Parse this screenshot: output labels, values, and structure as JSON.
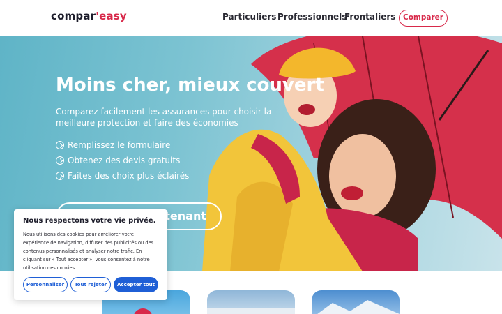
{
  "header": {
    "logo": {
      "part1": "compar",
      "part2": "'easy"
    },
    "nav": [
      {
        "label": "Particuliers"
      },
      {
        "label": "Professionnels"
      },
      {
        "label": "Frontaliers"
      }
    ],
    "cta_label": "Comparer"
  },
  "hero": {
    "title": "Moins cher, mieux couvert",
    "subtitle": "Comparez facilement les assurances pour choisir la meilleure protection et faire des économies",
    "bullets": [
      {
        "icon": "arrow-circle-right-icon",
        "text": "Remplissez le formulaire"
      },
      {
        "icon": "arrow-circle-right-icon",
        "text": "Obtenez des devis gratuits"
      },
      {
        "icon": "arrow-circle-right-icon",
        "text": "Faites des choix plus éclairés"
      }
    ],
    "cta_label": "tenant"
  },
  "cookie": {
    "title": "Nous respectons votre vie privée.",
    "text": "Nous utilisons des cookies pour améliorer votre expérience de navigation, diffuser des publicités ou des contenus personnalisés et analyser notre trafic. En cliquant sur « Tout accepter », vous consentez à notre utilisation des cookies.",
    "buttons": {
      "customize": "Personnaliser",
      "reject": "Tout rejeter",
      "accept": "Accepter tout"
    }
  },
  "colors": {
    "brand_red": "#d8294a",
    "brand_dark": "#1d1d2b",
    "cookie_blue": "#1f5fd6",
    "hero_teal": "#7cc3d2"
  }
}
